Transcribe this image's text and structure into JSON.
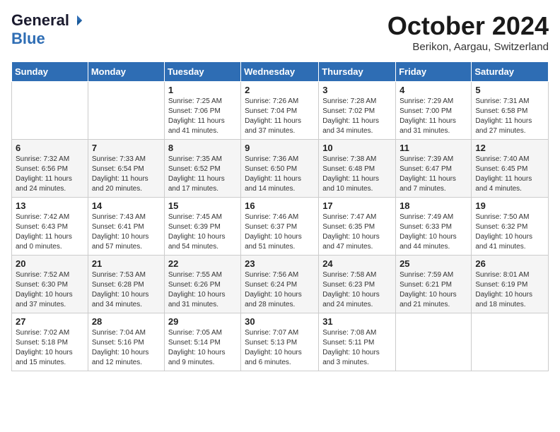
{
  "header": {
    "logo_general": "General",
    "logo_blue": "Blue",
    "month_title": "October 2024",
    "location": "Berikon, Aargau, Switzerland"
  },
  "days_of_week": [
    "Sunday",
    "Monday",
    "Tuesday",
    "Wednesday",
    "Thursday",
    "Friday",
    "Saturday"
  ],
  "weeks": [
    [
      {
        "day": "",
        "info": ""
      },
      {
        "day": "",
        "info": ""
      },
      {
        "day": "1",
        "info": "Sunrise: 7:25 AM\nSunset: 7:06 PM\nDaylight: 11 hours and 41 minutes."
      },
      {
        "day": "2",
        "info": "Sunrise: 7:26 AM\nSunset: 7:04 PM\nDaylight: 11 hours and 37 minutes."
      },
      {
        "day": "3",
        "info": "Sunrise: 7:28 AM\nSunset: 7:02 PM\nDaylight: 11 hours and 34 minutes."
      },
      {
        "day": "4",
        "info": "Sunrise: 7:29 AM\nSunset: 7:00 PM\nDaylight: 11 hours and 31 minutes."
      },
      {
        "day": "5",
        "info": "Sunrise: 7:31 AM\nSunset: 6:58 PM\nDaylight: 11 hours and 27 minutes."
      }
    ],
    [
      {
        "day": "6",
        "info": "Sunrise: 7:32 AM\nSunset: 6:56 PM\nDaylight: 11 hours and 24 minutes."
      },
      {
        "day": "7",
        "info": "Sunrise: 7:33 AM\nSunset: 6:54 PM\nDaylight: 11 hours and 20 minutes."
      },
      {
        "day": "8",
        "info": "Sunrise: 7:35 AM\nSunset: 6:52 PM\nDaylight: 11 hours and 17 minutes."
      },
      {
        "day": "9",
        "info": "Sunrise: 7:36 AM\nSunset: 6:50 PM\nDaylight: 11 hours and 14 minutes."
      },
      {
        "day": "10",
        "info": "Sunrise: 7:38 AM\nSunset: 6:48 PM\nDaylight: 11 hours and 10 minutes."
      },
      {
        "day": "11",
        "info": "Sunrise: 7:39 AM\nSunset: 6:47 PM\nDaylight: 11 hours and 7 minutes."
      },
      {
        "day": "12",
        "info": "Sunrise: 7:40 AM\nSunset: 6:45 PM\nDaylight: 11 hours and 4 minutes."
      }
    ],
    [
      {
        "day": "13",
        "info": "Sunrise: 7:42 AM\nSunset: 6:43 PM\nDaylight: 11 hours and 0 minutes."
      },
      {
        "day": "14",
        "info": "Sunrise: 7:43 AM\nSunset: 6:41 PM\nDaylight: 10 hours and 57 minutes."
      },
      {
        "day": "15",
        "info": "Sunrise: 7:45 AM\nSunset: 6:39 PM\nDaylight: 10 hours and 54 minutes."
      },
      {
        "day": "16",
        "info": "Sunrise: 7:46 AM\nSunset: 6:37 PM\nDaylight: 10 hours and 51 minutes."
      },
      {
        "day": "17",
        "info": "Sunrise: 7:47 AM\nSunset: 6:35 PM\nDaylight: 10 hours and 47 minutes."
      },
      {
        "day": "18",
        "info": "Sunrise: 7:49 AM\nSunset: 6:33 PM\nDaylight: 10 hours and 44 minutes."
      },
      {
        "day": "19",
        "info": "Sunrise: 7:50 AM\nSunset: 6:32 PM\nDaylight: 10 hours and 41 minutes."
      }
    ],
    [
      {
        "day": "20",
        "info": "Sunrise: 7:52 AM\nSunset: 6:30 PM\nDaylight: 10 hours and 37 minutes."
      },
      {
        "day": "21",
        "info": "Sunrise: 7:53 AM\nSunset: 6:28 PM\nDaylight: 10 hours and 34 minutes."
      },
      {
        "day": "22",
        "info": "Sunrise: 7:55 AM\nSunset: 6:26 PM\nDaylight: 10 hours and 31 minutes."
      },
      {
        "day": "23",
        "info": "Sunrise: 7:56 AM\nSunset: 6:24 PM\nDaylight: 10 hours and 28 minutes."
      },
      {
        "day": "24",
        "info": "Sunrise: 7:58 AM\nSunset: 6:23 PM\nDaylight: 10 hours and 24 minutes."
      },
      {
        "day": "25",
        "info": "Sunrise: 7:59 AM\nSunset: 6:21 PM\nDaylight: 10 hours and 21 minutes."
      },
      {
        "day": "26",
        "info": "Sunrise: 8:01 AM\nSunset: 6:19 PM\nDaylight: 10 hours and 18 minutes."
      }
    ],
    [
      {
        "day": "27",
        "info": "Sunrise: 7:02 AM\nSunset: 5:18 PM\nDaylight: 10 hours and 15 minutes."
      },
      {
        "day": "28",
        "info": "Sunrise: 7:04 AM\nSunset: 5:16 PM\nDaylight: 10 hours and 12 minutes."
      },
      {
        "day": "29",
        "info": "Sunrise: 7:05 AM\nSunset: 5:14 PM\nDaylight: 10 hours and 9 minutes."
      },
      {
        "day": "30",
        "info": "Sunrise: 7:07 AM\nSunset: 5:13 PM\nDaylight: 10 hours and 6 minutes."
      },
      {
        "day": "31",
        "info": "Sunrise: 7:08 AM\nSunset: 5:11 PM\nDaylight: 10 hours and 3 minutes."
      },
      {
        "day": "",
        "info": ""
      },
      {
        "day": "",
        "info": ""
      }
    ]
  ]
}
